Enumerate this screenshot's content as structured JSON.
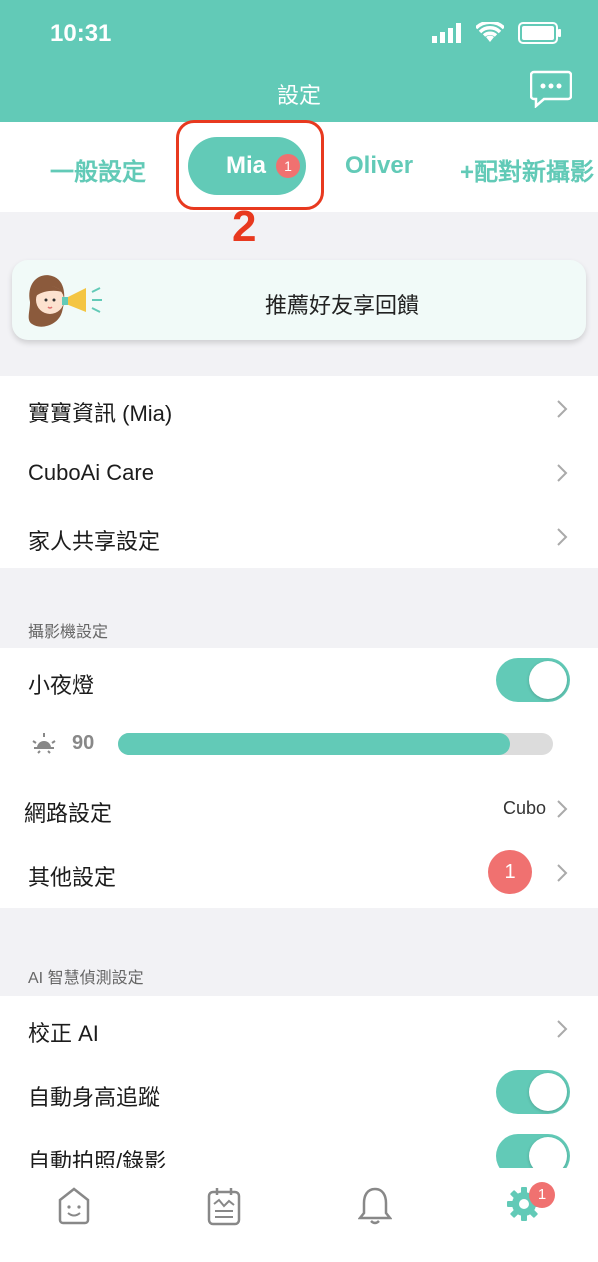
{
  "status_bar": {
    "time": "10:31"
  },
  "header": {
    "title": "設定"
  },
  "tabs": {
    "general": "一般設定",
    "active": "Mia",
    "active_badge": "1",
    "second": "Oliver",
    "add": "+配對新攝影"
  },
  "annotation": {
    "label": "2"
  },
  "banner": {
    "label": "推薦好友享回饋"
  },
  "baby_section": {
    "items": [
      {
        "label": "寶寶資訊 (Mia)"
      },
      {
        "label": "CuboAi Care"
      },
      {
        "label": "家人共享設定"
      }
    ]
  },
  "camera_section": {
    "header": "攝影機設定",
    "night_light": {
      "label": "小夜燈",
      "on": true
    },
    "brightness": {
      "value": "90",
      "fraction": 0.9
    },
    "network": {
      "label": "網路設定",
      "value": "Cubo"
    },
    "other": {
      "label": "其他設定",
      "badge": "1"
    }
  },
  "ai_section": {
    "header": "AI 智慧偵測設定",
    "calibrate": {
      "label": "校正 AI"
    },
    "auto_height": {
      "label": "自動身高追蹤",
      "on": true
    },
    "auto_photo": {
      "label": "自動拍照/錄影",
      "on": true
    }
  },
  "bottom_nav": {
    "items": [
      {
        "icon": "home-face-icon"
      },
      {
        "icon": "journal-icon"
      },
      {
        "icon": "bell-icon"
      },
      {
        "icon": "gear-icon",
        "badge": "1"
      }
    ]
  },
  "colors": {
    "accent": "#62cab7",
    "badge": "#f07170",
    "annotation": "#e8391f"
  }
}
